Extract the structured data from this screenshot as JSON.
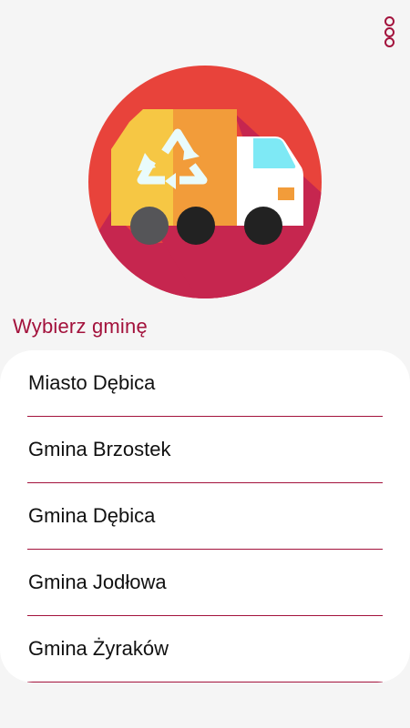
{
  "header": {
    "menu_icon": "more-vert-icon",
    "accent_color": "#a3123c"
  },
  "logo": {
    "icon": "recycling-truck-icon",
    "colors": {
      "circle": "#e8433b",
      "shadow": "#c6264f",
      "cargo_left": "#f6c744",
      "cargo_right": "#f29c3a",
      "cab": "#ffffff",
      "window": "#7ee9f5",
      "wheel": "#222222",
      "arrows": "#e9fbfb"
    }
  },
  "section": {
    "title": "Wybierz gminę"
  },
  "municipalities": [
    {
      "label": "Miasto Dębica"
    },
    {
      "label": "Gmina Brzostek"
    },
    {
      "label": "Gmina Dębica"
    },
    {
      "label": "Gmina Jodłowa"
    },
    {
      "label": "Gmina Żyraków"
    }
  ]
}
